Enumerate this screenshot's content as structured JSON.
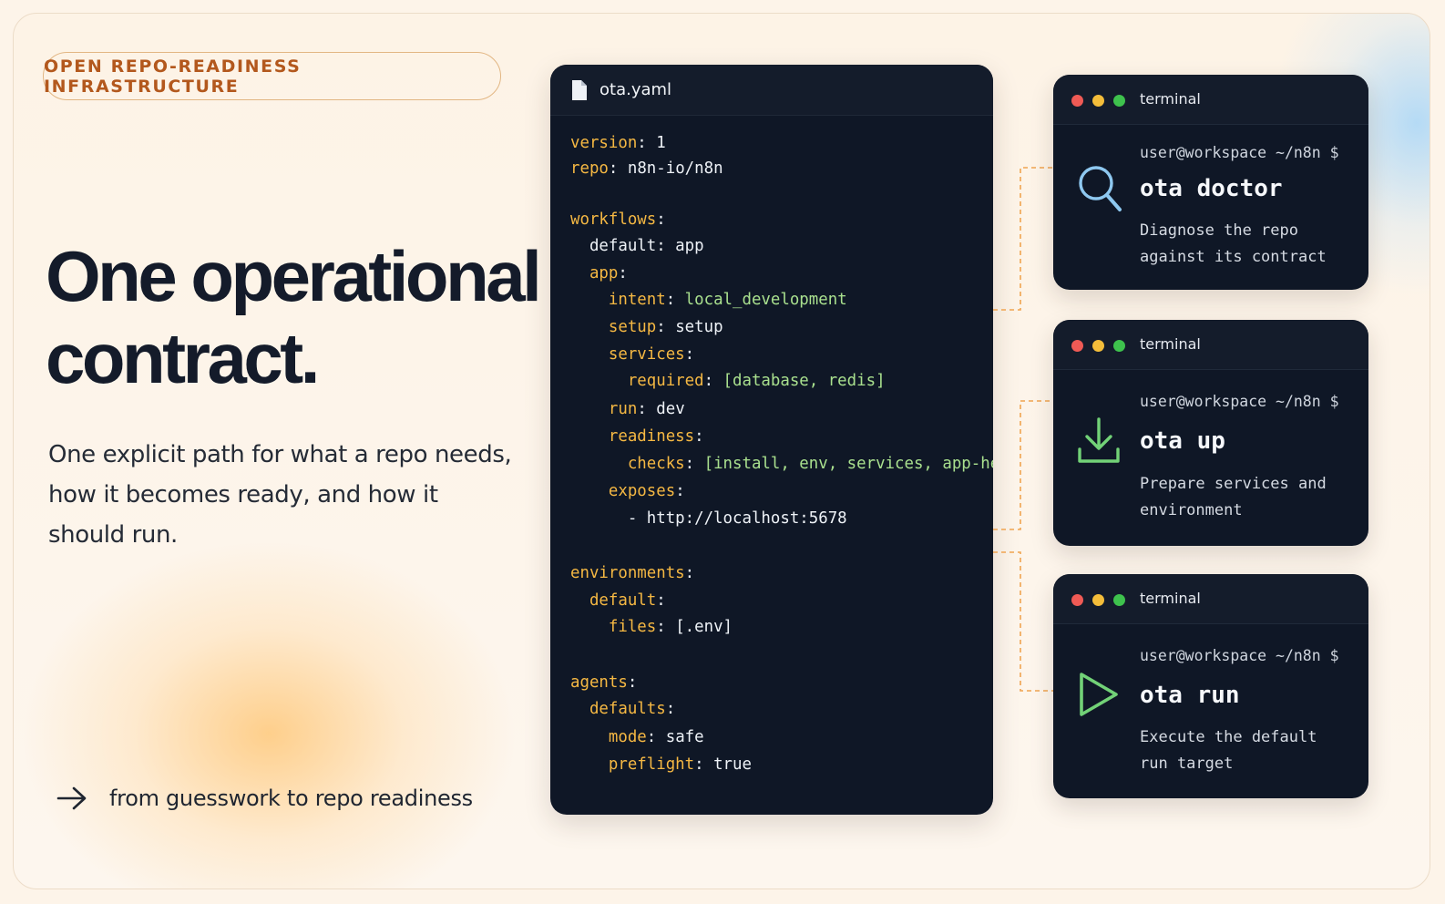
{
  "badge": "OPEN REPO-READINESS INFRASTRUCTURE",
  "headline": [
    "One operational",
    "contract."
  ],
  "subheading": [
    "One explicit path for what a repo needs,",
    "how it becomes ready, and how it",
    "should run."
  ],
  "tagline": "from guesswork to repo readiness",
  "colors": {
    "accent": "#b3581d",
    "yaml_key": "#f5b843",
    "yaml_string": "#a9e08e",
    "panel_bg": "#0f1726"
  },
  "yaml_panel": {
    "filename": "ota.yaml",
    "lines": [
      {
        "indent": "",
        "key": "version",
        "sep": ": ",
        "value": "1",
        "vtype": "v"
      },
      {
        "indent": "",
        "key": "repo",
        "sep": ": ",
        "value": "n8n-io/n8n",
        "vtype": "v"
      },
      {
        "indent": "",
        "key": "workflows",
        "sep": ":",
        "value": "",
        "vtype": "v"
      },
      {
        "indent": "  ",
        "key": "",
        "sep": "",
        "value": "default: app",
        "vtype": "v"
      },
      {
        "indent": "  ",
        "key": "app",
        "sep": ":",
        "value": "",
        "vtype": "v"
      },
      {
        "indent": "    ",
        "key": "intent",
        "sep": ": ",
        "value": "local_development",
        "vtype": "s"
      },
      {
        "indent": "    ",
        "key": "setup",
        "sep": ": ",
        "value": "setup",
        "vtype": "v"
      },
      {
        "indent": "    ",
        "key": "services",
        "sep": ":",
        "value": "",
        "vtype": "v"
      },
      {
        "indent": "      ",
        "key": "required",
        "sep": ": ",
        "value": "[database, redis]",
        "vtype": "s"
      },
      {
        "indent": "    ",
        "key": "run",
        "sep": ": ",
        "value": "dev",
        "vtype": "v"
      },
      {
        "indent": "    ",
        "key": "readiness",
        "sep": ":",
        "value": "",
        "vtype": "v"
      },
      {
        "indent": "      ",
        "key": "checks",
        "sep": ": ",
        "value": "[install, env, services, app-health]",
        "vtype": "s"
      },
      {
        "indent": "    ",
        "key": "exposes",
        "sep": ":",
        "value": "",
        "vtype": "v"
      },
      {
        "indent": "      ",
        "key": "",
        "sep": "",
        "value": "- http://localhost:5678",
        "vtype": "v"
      },
      {
        "indent": "",
        "key": "environments",
        "sep": ":",
        "value": "",
        "vtype": "v"
      },
      {
        "indent": "  ",
        "key": "default",
        "sep": ":",
        "value": "",
        "vtype": "v"
      },
      {
        "indent": "    ",
        "key": "files",
        "sep": ": ",
        "value": "[.env]",
        "vtype": "v"
      },
      {
        "indent": "",
        "key": "agents",
        "sep": ":",
        "value": "",
        "vtype": "v"
      },
      {
        "indent": "  ",
        "key": "defaults",
        "sep": ":",
        "value": "",
        "vtype": "v"
      },
      {
        "indent": "    ",
        "key": "mode",
        "sep": ": ",
        "value": "safe",
        "vtype": "v"
      },
      {
        "indent": "    ",
        "key": "preflight",
        "sep": ": ",
        "value": "true",
        "vtype": "v"
      }
    ]
  },
  "terminals": [
    {
      "label": "terminal",
      "prompt": "user@workspace ~/n8n $",
      "command": "ota doctor",
      "description": [
        "Diagnose the repo",
        "against its contract"
      ],
      "icon": "search-icon",
      "icon_color": "#8ec8f0"
    },
    {
      "label": "terminal",
      "prompt": "user@workspace ~/n8n $",
      "command": "ota up",
      "description": [
        "Prepare services and",
        "environment"
      ],
      "icon": "download-icon",
      "icon_color": "#72d277"
    },
    {
      "label": "terminal",
      "prompt": "user@workspace ~/n8n $",
      "command": "ota run",
      "description": [
        "Execute the default",
        "run target"
      ],
      "icon": "play-icon",
      "icon_color": "#72d277"
    }
  ]
}
